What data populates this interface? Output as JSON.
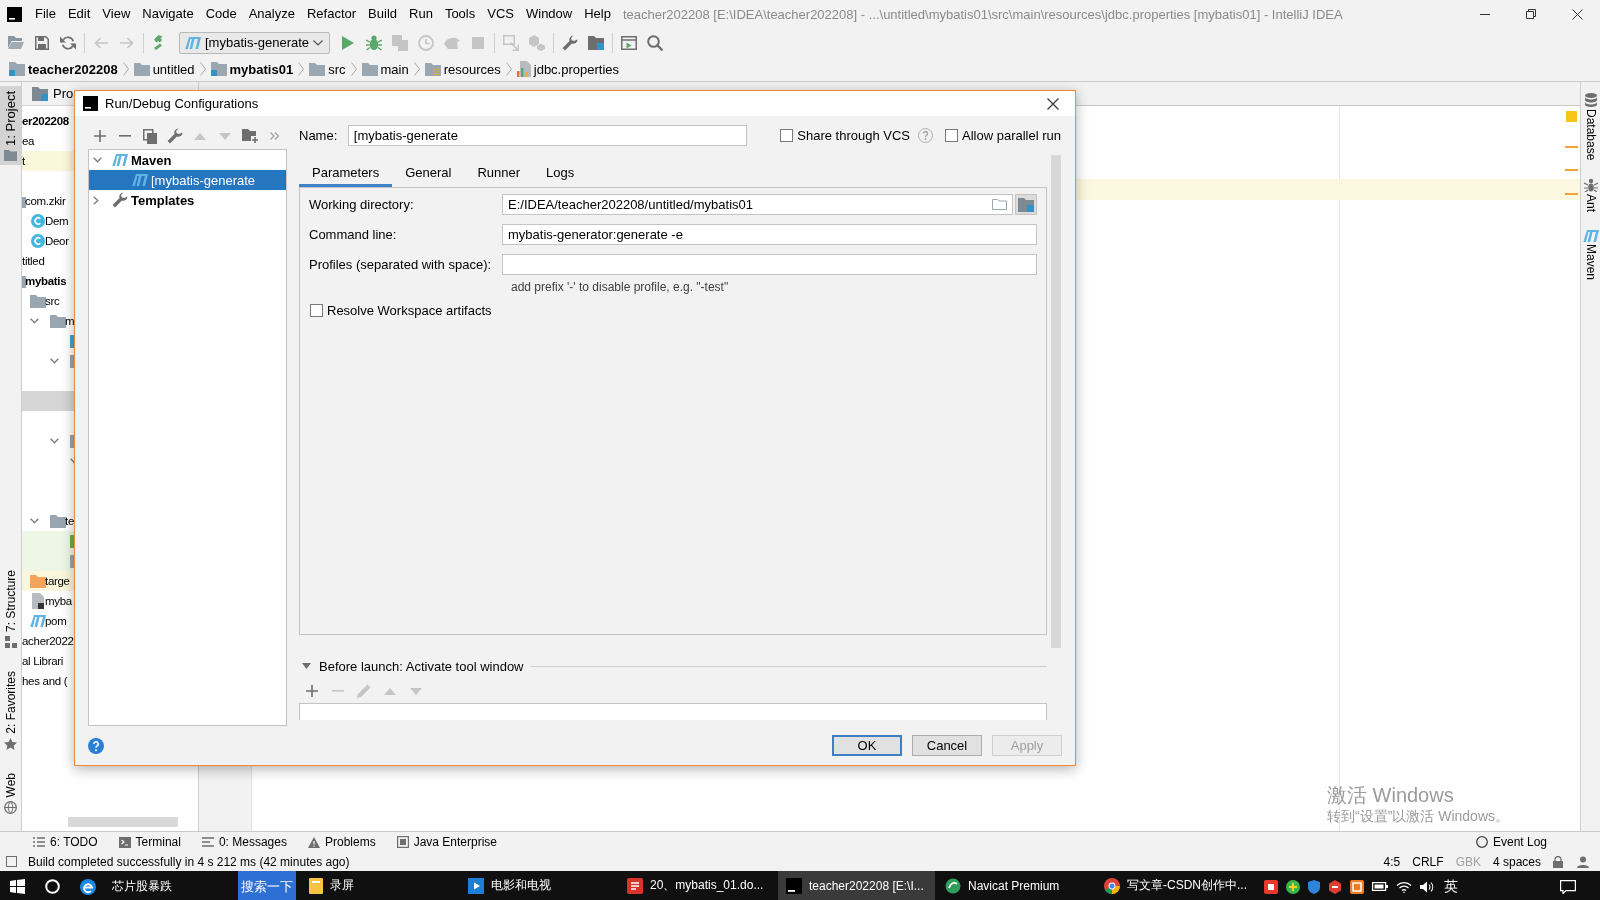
{
  "window": {
    "title": "teacher202208 [E:\\IDEA\\teacher202208] - ...\\untitled\\mybatis01\\src\\main\\resources\\jdbc.properties [mybatis01] - IntelliJ IDEA"
  },
  "menu": [
    "File",
    "Edit",
    "View",
    "Navigate",
    "Code",
    "Analyze",
    "Refactor",
    "Build",
    "Run",
    "Tools",
    "VCS",
    "Window",
    "Help"
  ],
  "toolbar": {
    "items": [
      {
        "kind": "open",
        "disabled": false
      },
      {
        "kind": "save",
        "disabled": false
      },
      {
        "kind": "sync",
        "disabled": false
      },
      {
        "kind": "separator"
      },
      {
        "kind": "back",
        "disabled": true
      },
      {
        "kind": "forward",
        "disabled": true
      },
      {
        "kind": "separator"
      },
      {
        "kind": "build",
        "disabled": false
      },
      {
        "kind": "run-config",
        "label": "[mybatis-generate"
      },
      {
        "kind": "run",
        "disabled": false
      },
      {
        "kind": "debug",
        "disabled": false
      },
      {
        "kind": "coverage",
        "disabled": true
      },
      {
        "kind": "profile",
        "disabled": true
      },
      {
        "kind": "dump",
        "disabled": true
      },
      {
        "kind": "stop",
        "disabled": true
      },
      {
        "kind": "separator"
      },
      {
        "kind": "attach",
        "disabled": true
      },
      {
        "kind": "modules",
        "disabled": true
      },
      {
        "kind": "separator"
      },
      {
        "kind": "settings",
        "disabled": false
      },
      {
        "kind": "structure",
        "disabled": false
      },
      {
        "kind": "separator"
      },
      {
        "kind": "run-anything",
        "disabled": false
      },
      {
        "kind": "search",
        "disabled": false
      }
    ]
  },
  "breadcrumbs": [
    {
      "label": "teacher202208",
      "kind": "module"
    },
    {
      "label": "untitled",
      "kind": "folder"
    },
    {
      "label": "mybatis01",
      "kind": "module"
    },
    {
      "label": "src",
      "kind": "folder"
    },
    {
      "label": "main",
      "kind": "folder"
    },
    {
      "label": "resources",
      "kind": "resources"
    },
    {
      "label": "jdbc.properties",
      "kind": "properties"
    }
  ],
  "left_strip": {
    "top": [
      {
        "label": "1: Project",
        "kind": "project",
        "selected": true
      }
    ],
    "bottom": [
      {
        "label": "7: Structure",
        "kind": "structure",
        "selected": false
      },
      {
        "label": "2: Favorites",
        "kind": "favorites",
        "selected": false
      },
      {
        "label": "Web",
        "kind": "web",
        "selected": false
      }
    ]
  },
  "project_panel": {
    "title": "Pro",
    "tree": [
      {
        "label": "er202208",
        "kind": "module",
        "selected": false,
        "children": [
          {
            "label": "ea",
            "selected": false
          },
          {
            "label": "t",
            "selected": false,
            "color": "#fbf7dc"
          },
          {
            "selected": false,
            "children": [
              {
                "label": "com.zkir",
                "kind": "package",
                "selected": false,
                "children": [
                  {
                    "label": "Dem",
                    "kind": "class",
                    "selected": false
                  },
                  {
                    "label": "Deor",
                    "kind": "class",
                    "selected": false
                  }
                ]
              }
            ]
          },
          {
            "label": "titled",
            "selected": false,
            "children": [
              {
                "label": "mybatis",
                "kind": "module",
                "selected": false,
                "children": [
                  {
                    "label": "src",
                    "kind": "folder",
                    "selected": false,
                    "children": [
                      {
                        "label": "m",
                        "kind": "folder",
                        "expanded": true,
                        "selected": false,
                        "children": [
                          {
                            "kind": "source-folder",
                            "selected": false
                          },
                          {
                            "kind": "resources-folder",
                            "expanded": true,
                            "selected": false,
                            "children": [
                              {
                                "selected": false
                              },
                              {
                                "selected": true
                              },
                              {
                                "selected": false
                              }
                            ]
                          },
                          {
                            "kind": "folder",
                            "expanded": true,
                            "selected": false,
                            "children": [
                              {
                                "expanded": true,
                                "selected": false,
                                "children": [
                                  {
                                    "selected": false
                                  },
                                  {
                                    "selected": false
                                  }
                                ]
                              }
                            ]
                          }
                        ]
                      },
                      {
                        "label": "te",
                        "kind": "folder",
                        "expanded": true,
                        "selected": false,
                        "children": [
                          {
                            "kind": "test-folder",
                            "selected": false,
                            "color": "#eef7e6"
                          },
                          {
                            "kind": "test-resources-folder",
                            "selected": false,
                            "color": "#eef7e6"
                          }
                        ]
                      }
                    ]
                  },
                  {
                    "label": "targe",
                    "kind": "excluded-folder",
                    "selected": false,
                    "color": "#fbf7dc"
                  },
                  {
                    "label": "myba",
                    "kind": "file",
                    "selected": false
                  },
                  {
                    "label": "pom",
                    "kind": "maven-file",
                    "selected": false
                  }
                ]
              }
            ]
          },
          {
            "label": "acher2022",
            "selected": false
          }
        ]
      },
      {
        "label": "al Librari",
        "selected": false
      },
      {
        "label": "hes and (",
        "selected": false
      }
    ]
  },
  "right_strip": [
    {
      "label": "Database",
      "kind": "database"
    },
    {
      "label": "Ant",
      "kind": "ant"
    },
    {
      "label": "Maven",
      "kind": "maven"
    }
  ],
  "dialog": {
    "title": "Run/Debug Configurations",
    "toolbar": [
      {
        "kind": "add",
        "disabled": false
      },
      {
        "kind": "remove",
        "disabled": false
      },
      {
        "kind": "copy",
        "disabled": false
      },
      {
        "kind": "edit-defaults",
        "disabled": false
      },
      {
        "kind": "move-up",
        "disabled": true
      },
      {
        "kind": "move-down",
        "disabled": true
      },
      {
        "kind": "new-folder",
        "disabled": false
      },
      {
        "kind": "more",
        "disabled": false
      }
    ],
    "tree": [
      {
        "label": "Maven",
        "kind": "maven",
        "expanded": true,
        "selected": false,
        "children": [
          {
            "label": "[mybatis-generate",
            "kind": "maven",
            "selected": true
          }
        ]
      },
      {
        "label": "Templates",
        "kind": "templates",
        "expanded": false,
        "selected": false
      }
    ],
    "name": {
      "label": "Name:",
      "value": "[mybatis-generate"
    },
    "options": [
      {
        "label": "Share through VCS",
        "checked": false,
        "help": true
      },
      {
        "label": "Allow parallel run",
        "checked": false
      }
    ],
    "tabs": [
      {
        "label": "Parameters",
        "selected": true
      },
      {
        "label": "General",
        "selected": false
      },
      {
        "label": "Runner",
        "selected": false
      },
      {
        "label": "Logs",
        "selected": false
      }
    ],
    "fields": [
      {
        "label": "Working directory:",
        "value": "E:/IDEA/teacher202208/untitled/mybatis01",
        "browse": true
      },
      {
        "label": "Command line:",
        "value": "mybatis-generator:generate -e"
      },
      {
        "label": "Profiles (separated with space):",
        "hint": "add prefix '-' to disable profile, e.g. \"-test\""
      }
    ],
    "resolve_workspace": {
      "label": "Resolve Workspace artifacts",
      "checked": false
    },
    "before_launch": {
      "label": "Before launch: Activate tool window",
      "expanded": true,
      "toolbar": [
        {
          "kind": "add",
          "disabled": false
        },
        {
          "kind": "remove",
          "disabled": true
        },
        {
          "kind": "edit",
          "disabled": true
        },
        {
          "kind": "move-up",
          "disabled": true
        },
        {
          "kind": "move-down",
          "disabled": true
        }
      ]
    },
    "buttons": [
      {
        "label": "OK",
        "kind": "default",
        "disabled": false
      },
      {
        "label": "Cancel",
        "kind": "normal",
        "disabled": false
      },
      {
        "label": "Apply",
        "kind": "normal",
        "disabled": true
      }
    ]
  },
  "bottom_tabs": {
    "left": [
      {
        "label": "6: TODO",
        "kind": "todo"
      },
      {
        "label": "Terminal",
        "kind": "terminal"
      },
      {
        "label": "0: Messages",
        "kind": "messages"
      },
      {
        "label": "Problems",
        "kind": "problems"
      },
      {
        "label": "Java Enterprise",
        "kind": "enterprise"
      }
    ],
    "right": [
      {
        "label": "Event Log",
        "kind": "event-log"
      }
    ]
  },
  "status_bar": {
    "message": "Build completed successfully in 4 s 212 ms (42 minutes ago)",
    "items": [
      {
        "label": "4:5",
        "disabled": false
      },
      {
        "label": "CRLF",
        "disabled": false
      },
      {
        "label": "GBK",
        "disabled": true
      },
      {
        "label": "4 spaces",
        "disabled": false
      }
    ]
  },
  "taskbar": {
    "widgets": [
      {
        "label": "芯片股暴跌",
        "kind": "news"
      },
      {
        "label": "搜索一下",
        "kind": "search"
      }
    ],
    "apps": [
      {
        "label": "录屏",
        "kind": "recorder",
        "selected": false
      },
      {
        "label": "电影和电视",
        "kind": "video",
        "selected": false
      },
      {
        "label": "20、mybatis_01.do...",
        "kind": "document",
        "selected": false
      },
      {
        "label": "teacher202208 [E:\\I...",
        "kind": "ide",
        "selected": true
      },
      {
        "label": "Navicat Premium",
        "kind": "database",
        "selected": false
      },
      {
        "label": "写文章-CSDN创作中...",
        "kind": "browser",
        "selected": false
      }
    ],
    "input_method": "英"
  },
  "activation_notice": {
    "title": "激活 Windows",
    "hint": "转到“设置”以激活 Windows。"
  }
}
